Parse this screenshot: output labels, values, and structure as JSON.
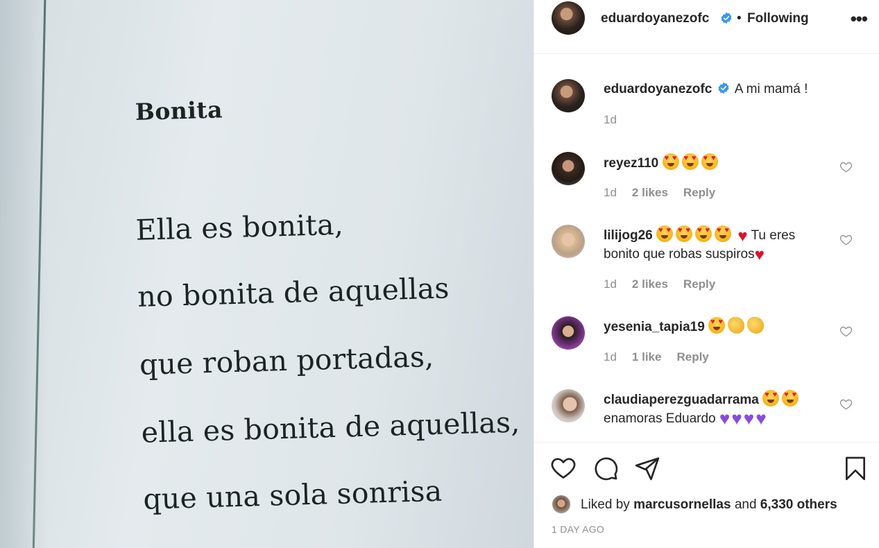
{
  "post_image": {
    "title": "Bonita",
    "lines": [
      "Ella es bonita,",
      "no bonita de aquellas",
      "que roban portadas,",
      "ella es bonita de aquellas,",
      "que una sola sonrisa"
    ]
  },
  "header": {
    "username": "eduardoyanezofc",
    "separator": "•",
    "follow_state": "Following",
    "more_icon": "more-horizontal-icon",
    "more_label": "•••"
  },
  "caption": {
    "username": "eduardoyanezofc",
    "text": "A mi mamá !",
    "time": "1d"
  },
  "comments": [
    {
      "username": "reyez110",
      "text": "",
      "emojis_before": [
        "heart-eyes",
        "heart-eyes",
        "heart-eyes"
      ],
      "time": "1d",
      "likes": "2 likes",
      "reply": "Reply"
    },
    {
      "username": "lilijog26",
      "text_a": "Tu eres",
      "text_b": "bonito que robas suspiros",
      "emojis_before": [
        "heart-eyes",
        "heart-eyes",
        "heart-eyes",
        "heart-eyes",
        "red-heart"
      ],
      "time": "1d",
      "likes": "2 likes",
      "reply": "Reply"
    },
    {
      "username": "yesenia_tapia19",
      "text": "",
      "emojis_before": [
        "heart-eyes",
        "clapping-hands",
        "clapping-hands"
      ],
      "time": "1d",
      "likes": "1 like",
      "reply": "Reply"
    },
    {
      "username": "claudiaperezguadarrama",
      "text": "enamoras Eduardo",
      "emojis_before": [
        "heart-eyes",
        "heart-eyes"
      ],
      "emojis_after": [
        "purple-heart",
        "purple-heart",
        "purple-heart",
        "purple-heart"
      ]
    }
  ],
  "actions": {
    "like_icon": "heart-icon",
    "comment_icon": "comment-icon",
    "share_icon": "paper-plane-icon",
    "save_icon": "bookmark-icon"
  },
  "likes": {
    "prefix": "Liked by",
    "user": "marcusornellas",
    "middle": "and",
    "others": "6,330 others"
  },
  "timestamp": "1 DAY AGO",
  "colors": {
    "text": "#262626",
    "muted": "#8e8e8e",
    "verified": "#3897f0",
    "border": "#efefef"
  }
}
